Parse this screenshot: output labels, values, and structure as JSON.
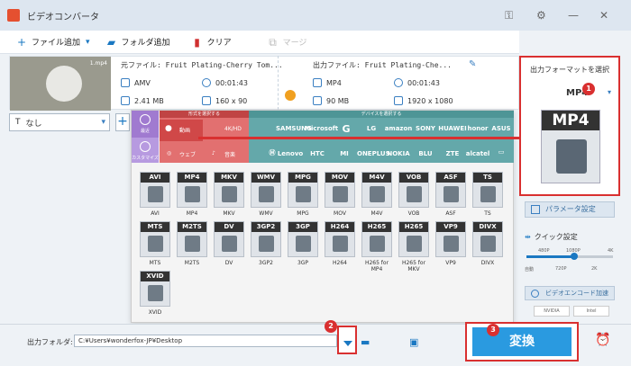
{
  "app": {
    "title": "ビデオコンバータ"
  },
  "toolbar": {
    "add_file": "ファイル追加",
    "add_folder": "フォルダ追加",
    "clear": "クリア",
    "merge": "マージ"
  },
  "source": {
    "filename": "元ファイル: Fruit Plating-Cherry Tom...",
    "format": "AMV",
    "duration": "00:01:43",
    "size": "2.41 MB",
    "resolution": "160 x 90"
  },
  "output": {
    "filename": "出力ファイル: Fruit Plating-Che...",
    "format": "MP4",
    "duration": "00:01:43",
    "size": "90 MB",
    "resolution": "1920 x 1080"
  },
  "thumbnail": {
    "tag": "1.mp4"
  },
  "subtitle": {
    "value": "なし"
  },
  "categories": {
    "video_header": "形式を選択する",
    "device_header": "デバイスを選択する",
    "video": "動画",
    "hd": "4K/HD",
    "web": "ウェブ",
    "audio": "音楽",
    "cat1": "最近",
    "cat2": "カスタマイズ"
  },
  "brands": [
    "SAMSUNG",
    "Microsoft",
    "G",
    "LG",
    "amazon",
    "SONY",
    "HUAWEI",
    "honor",
    "ASUS",
    "Lenovo",
    "HTC",
    "MI",
    "ONEPLUS",
    "NOKIA",
    "BLU",
    "ZTE",
    "alcatel"
  ],
  "formats": [
    {
      "badge": "AVI",
      "label": "AVI"
    },
    {
      "badge": "MP4",
      "label": "MP4"
    },
    {
      "badge": "MKV",
      "label": "MKV"
    },
    {
      "badge": "WMV",
      "label": "WMV"
    },
    {
      "badge": "MPG",
      "label": "MPG"
    },
    {
      "badge": "MOV",
      "label": "MOV"
    },
    {
      "badge": "M4V",
      "label": "M4V"
    },
    {
      "badge": "VOB",
      "label": "VOB"
    },
    {
      "badge": "ASF",
      "label": "ASF"
    },
    {
      "badge": "TS",
      "label": "TS"
    },
    {
      "badge": "MTS",
      "label": "MTS"
    },
    {
      "badge": "M2TS",
      "label": "M2TS"
    },
    {
      "badge": "DV",
      "label": "DV"
    },
    {
      "badge": "3GP2",
      "label": "3GP2"
    },
    {
      "badge": "3GP",
      "label": "3GP"
    },
    {
      "badge": "H264",
      "label": "H264"
    },
    {
      "badge": "H265",
      "label": "H265 for MP4"
    },
    {
      "badge": "H265",
      "label": "H265 for MKV"
    },
    {
      "badge": "VP9",
      "label": "VP9"
    },
    {
      "badge": "DIVX",
      "label": "DIVX"
    },
    {
      "badge": "XVID",
      "label": "XVID"
    }
  ],
  "right": {
    "title": "出力フォーマットを選択",
    "format": "MP4",
    "big": "MP4",
    "params": "パラメータ設定",
    "quick": "クイック設定",
    "ticks_top": [
      "480P",
      "1080P",
      "4K"
    ],
    "ticks_bottom": [
      "自動",
      "720P",
      "2K"
    ],
    "accel": "ビデオエンコード加速",
    "gpu1": "NVIDIA",
    "gpu2": "Intel",
    "quick_level": 0.55
  },
  "bottom": {
    "out_label": "出力フォルダ:",
    "path": "C:¥Users¥wonderfox-JP¥Desktop",
    "convert": "変換"
  },
  "badges": [
    "1",
    "2",
    "3"
  ],
  "colors": {
    "accent": "#1a78c2",
    "highlight": "#d93030"
  }
}
